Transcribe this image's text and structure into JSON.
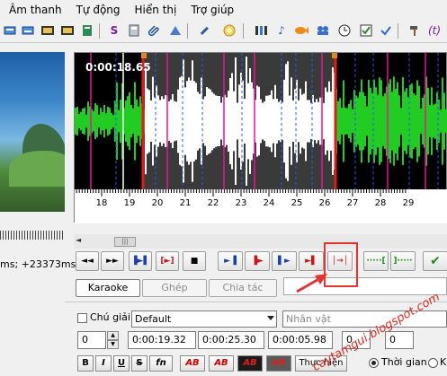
{
  "menu": [
    "Âm thanh",
    "Tự động",
    "Hiển thị",
    "Trợ giúp"
  ],
  "toolbar_icons": [
    "subtitle-icon",
    "subtitle-alt-icon",
    "film-icon",
    "film-alt-icon",
    "sign-icon",
    "calculator-icon",
    "attach-icon",
    "shapes-icon",
    "tools-icon",
    "sun-icon",
    "timing-icon",
    "music-note-icon",
    "fish-icon",
    "group-icon",
    "clock-icon",
    "checkbox-icon",
    "check-icon",
    "hammer-icon",
    "function-icon"
  ],
  "waveform": {
    "time_display": "0:00:18.65",
    "tick_labels": [
      "18",
      "19",
      "20",
      "21",
      "22",
      "23",
      "24",
      "25",
      "26",
      "27",
      "28",
      "29"
    ],
    "colors": {
      "background": "#000000",
      "selection": "#3a3a3a",
      "wave_outside": "#22cc22",
      "wave_inside": "#ffffff",
      "marker": "#e3169a",
      "selection_edge": "#e31b1b",
      "keyframe": "#1e5cff"
    }
  },
  "video": {
    "status": "ms; +23373ms"
  },
  "transport_icons": [
    "prev-line-icon",
    "next-line-icon",
    "play-selection-icon",
    "play-current-line-icon",
    "stop-icon",
    "play-before-icon",
    "play-begin-icon",
    "play-end-icon",
    "play-after-icon",
    "commit-marker-icon",
    "go-to-start-icon",
    "go-to-end-icon",
    "commit-icon"
  ],
  "tabs": {
    "karaoke": "Karaoke",
    "ghep": "Ghép",
    "chia_tac": "Chia tác"
  },
  "editor": {
    "comment_label": "Chú giải",
    "style": "Default",
    "actor_placeholder": "Nhân vật",
    "layer": "0",
    "start": "0:00:19.32",
    "end": "0:00:25.30",
    "duration": "0:00:05.98",
    "margin_l": "0",
    "margin_r": "0",
    "format_bold": "B",
    "format_italic": "I",
    "format_underline": "U",
    "format_strike": "S",
    "format_fn": "fn",
    "ab_label": "AB",
    "mode_button": "Thực hiện",
    "radio_time": "Thời gian",
    "radio_k": "K"
  },
  "watermark": "caytamgui.blogspot.com"
}
